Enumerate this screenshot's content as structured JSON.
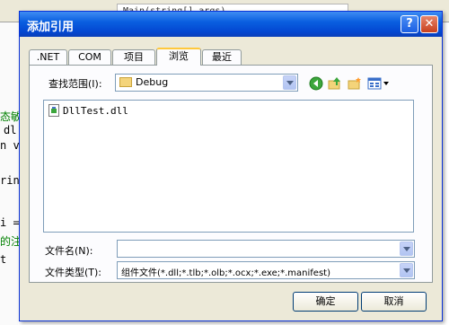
{
  "background_editor": {
    "doc_tab_text": "Main(string[] args)",
    "code_fragments": [
      {
        "text": "态敏",
        "color": "#008000"
      },
      {
        "text": "dl",
        "color": "#000000"
      },
      {
        "text": "n v",
        "color": "#000000"
      },
      {
        "text": "rin",
        "color": "#000000"
      },
      {
        "text": "i =",
        "color": "#000000"
      },
      {
        "text": "的注",
        "color": "#008000"
      },
      {
        "text": "t",
        "color": "#000000"
      }
    ]
  },
  "dialog": {
    "title": "添加引用",
    "help_label": "?",
    "close_label": "✕",
    "tabs": [
      {
        "label": ".NET"
      },
      {
        "label": "COM"
      },
      {
        "label": "项目"
      },
      {
        "label": "浏览",
        "active": true
      },
      {
        "label": "最近"
      }
    ],
    "lookin_label": "查找范围(I):",
    "lookin_value": "Debug",
    "toolbar_icons": [
      "back-icon",
      "up-folder-icon",
      "new-folder-icon",
      "views-menu-icon"
    ],
    "files": [
      {
        "name": "DllTest.dll",
        "icon": "dll-file-icon"
      }
    ],
    "filename_label": "文件名(N):",
    "filename_value": "",
    "filetype_label": "文件类型(T):",
    "filetype_value": "组件文件(*.dll;*.tlb;*.olb;*.ocx;*.exe;*.manifest)",
    "ok_label": "确定",
    "cancel_label": "取消"
  },
  "colors": {
    "titlebar": "#0a5fe0",
    "dialog_face": "#ece9d8",
    "accent_tab": "#ffc83c"
  }
}
